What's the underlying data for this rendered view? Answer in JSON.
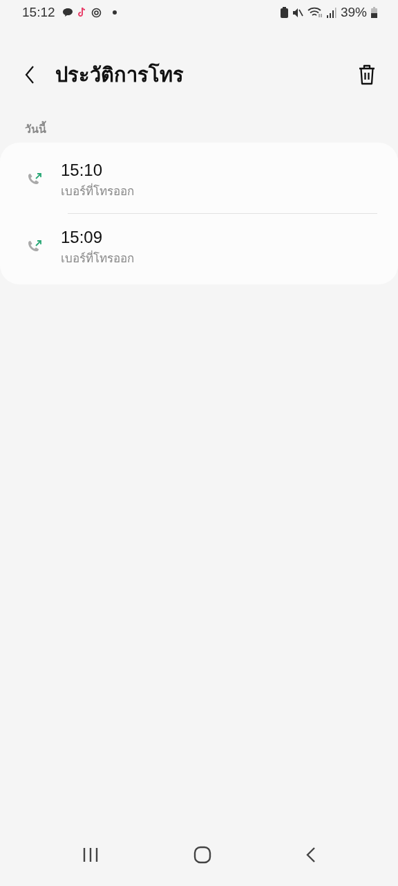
{
  "status_bar": {
    "time": "15:12",
    "battery": "39%"
  },
  "header": {
    "title": "ประวัติการโทร"
  },
  "section": {
    "label": "วันนี้"
  },
  "calls": [
    {
      "kind": "outgoing",
      "time": "15:10",
      "type_label": "เบอร์ที่โทรออก"
    },
    {
      "kind": "outgoing",
      "time": "15:09",
      "type_label": "เบอร์ที่โทรออก"
    }
  ]
}
